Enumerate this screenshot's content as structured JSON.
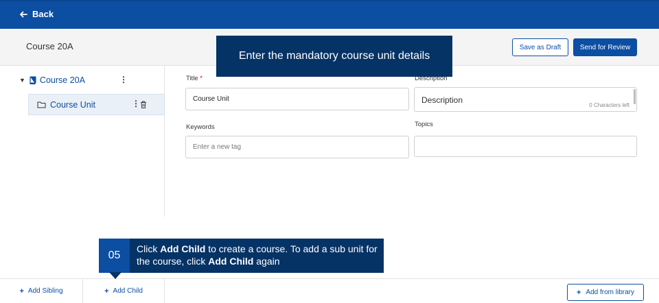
{
  "topbar": {
    "back_label": "Back"
  },
  "header": {
    "title": "Course 20A",
    "save_draft_label": "Save as Draft",
    "send_review_label": "Send for Review"
  },
  "callouts": {
    "top": "Enter the mandatory course unit details",
    "step_number": "05",
    "step_text_1": "Click ",
    "step_bold_1": "Add Child",
    "step_text_2": " to create a course. To add a sub unit for the course, click ",
    "step_bold_2": "Add Child",
    "step_text_3": " again"
  },
  "tree": {
    "root_label": "Course 20A",
    "child_label": "Course Unit"
  },
  "form": {
    "title_label": "Title",
    "title_required": "*",
    "title_value": "Course Unit",
    "description_label": "Description",
    "description_value": "Description",
    "chars_left": "0 Characters left",
    "keywords_label": "Keywords",
    "keywords_placeholder": "Enter a new tag",
    "topics_label": "Topics",
    "topics_value": ""
  },
  "bottombar": {
    "add_sibling_label": "Add Sibling",
    "add_child_label": "Add Child",
    "add_library_label": "Add from library"
  },
  "colors": {
    "brand": "#0b4ea2",
    "callout": "#063366"
  }
}
